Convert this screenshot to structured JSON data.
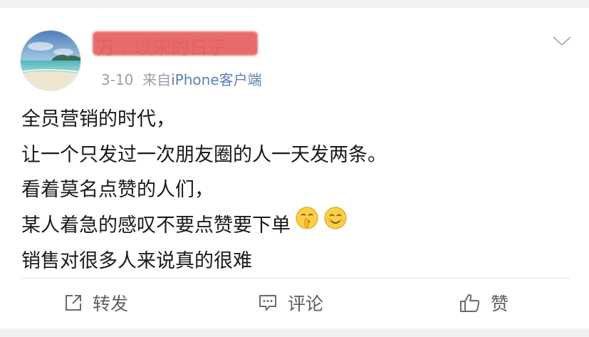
{
  "post": {
    "username": "万…以宋的日子",
    "date": "3-10",
    "source_prefix": "来自",
    "source_name": "iPhone客户端",
    "lines": [
      "全员营销的时代，",
      "让一个只发过一次朋友圈的人一天发两条。",
      "看着莫名点赞的人们，",
      "某人着急的感叹不要点赞要下单",
      "销售对很多人来说真的很难"
    ],
    "line4_emojis": [
      "shushing-face",
      "smiling-face"
    ]
  },
  "actions": {
    "repost_label": "转发",
    "comment_label": "评论",
    "like_label": "赞"
  },
  "colors": {
    "source_link": "#5b7fb1",
    "meta_text": "#9aa0a6",
    "redaction": "#e45757",
    "action_text": "#5e5e5e"
  }
}
